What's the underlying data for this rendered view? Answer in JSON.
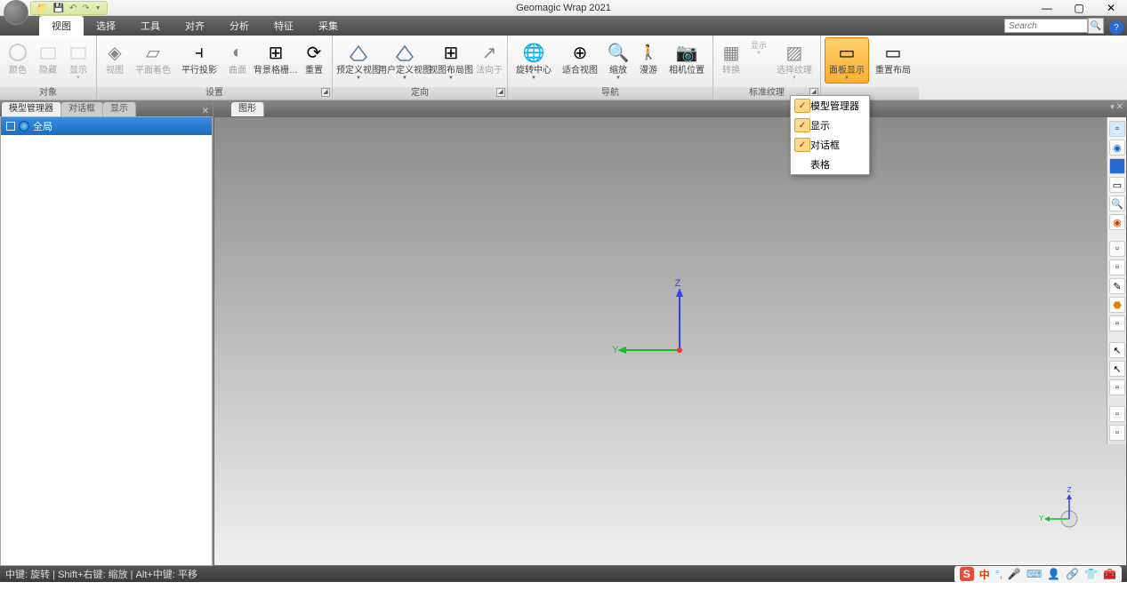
{
  "app": {
    "title": "Geomagic Wrap 2021"
  },
  "search": {
    "placeholder": "Search"
  },
  "menu": {
    "tabs": [
      "视图",
      "选择",
      "工具",
      "对齐",
      "分析",
      "特征",
      "采集"
    ],
    "active_index": 0
  },
  "ribbon": {
    "groups": [
      {
        "label": "对象",
        "items": [
          {
            "label": "颜色",
            "disabled": true
          },
          {
            "label": "隐藏",
            "disabled": true
          },
          {
            "label": "显示",
            "disabled": true,
            "dd": true
          }
        ]
      },
      {
        "label": "设置",
        "expander": true,
        "items": [
          {
            "label": "视图",
            "disabled": true
          },
          {
            "label": "平面着色",
            "disabled": true,
            "wide": true
          },
          {
            "label": "平行投影"
          },
          {
            "label": "曲面",
            "disabled": true
          },
          {
            "label": "背景格栅…",
            "wide": true
          },
          {
            "label": "重置"
          }
        ]
      },
      {
        "label": "定向",
        "expander": true,
        "items": [
          {
            "label": "预定义视图",
            "wide": true,
            "dd": true
          },
          {
            "label": "用户定义视图",
            "wide": true,
            "dd": true
          },
          {
            "label": "视图布局图",
            "wide": true,
            "dd": true
          },
          {
            "label": "法向于",
            "disabled": true
          }
        ]
      },
      {
        "label": "导航",
        "items": [
          {
            "label": "旋转中心",
            "wide": true,
            "dd": true
          },
          {
            "label": "适合视图",
            "wide": true
          },
          {
            "label": "缩放",
            "dd": true
          },
          {
            "label": "漫游"
          },
          {
            "label": "相机位置",
            "wide": true
          }
        ]
      },
      {
        "label": "标准纹理",
        "expander": true,
        "items": [
          {
            "label": "转换",
            "disabled": true
          },
          {
            "label": "显示",
            "disabled": true,
            "dd": true,
            "stack": true
          },
          {
            "label": "选择纹理",
            "disabled": true,
            "dd": true,
            "wide": true
          }
        ]
      },
      {
        "label": "",
        "items": [
          {
            "label": "面板显示",
            "wide": true,
            "dd": true,
            "active": true
          },
          {
            "label": "重置布局",
            "wide": true
          }
        ]
      }
    ]
  },
  "dropdown": {
    "items": [
      {
        "label": "模型管理器",
        "checked": true
      },
      {
        "label": "显示",
        "checked": true
      },
      {
        "label": "对话框",
        "checked": true
      },
      {
        "label": "表格",
        "checked": false
      }
    ]
  },
  "left_panel": {
    "tabs": [
      "模型管理器",
      "对话框",
      "显示"
    ],
    "active_index": 0,
    "root_item": "全局"
  },
  "viewport": {
    "tab": "图形",
    "axis_z": "Z",
    "axis_y": "Y"
  },
  "mini_axis": {
    "z": "Z",
    "y": "Y"
  },
  "statusbar": {
    "text": "中键: 旋转 | Shift+右键: 缩放 | Alt+中键: 平移",
    "ime": "中"
  }
}
